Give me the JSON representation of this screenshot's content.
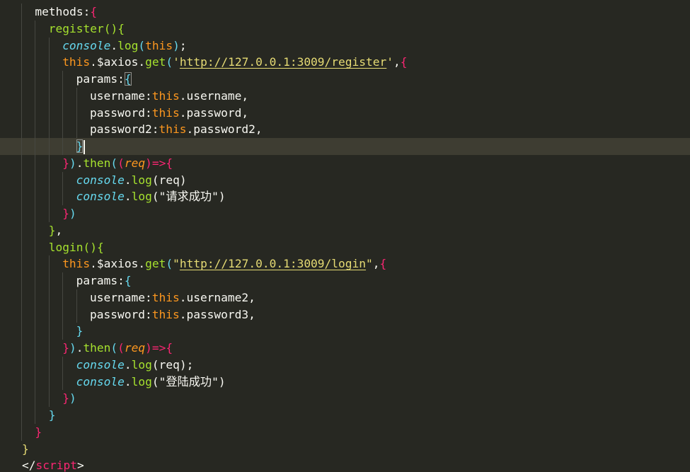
{
  "editor": {
    "theme_colors": {
      "background": "#272822",
      "current_line": "#3e3d32",
      "function": "#a6e22e",
      "keyword": "#fd971f",
      "property": "#66d9ef",
      "string": "#e6db74",
      "operator": "#f92672"
    },
    "lines": [
      {
        "indent": 2,
        "tokens": [
          {
            "t": "methods:",
            "c": "plain"
          },
          {
            "t": "{",
            "c": "p3"
          }
        ]
      },
      {
        "indent": 3,
        "tokens": [
          {
            "t": "register",
            "c": "fn"
          },
          {
            "t": "()",
            "c": "p2"
          },
          {
            "t": "{",
            "c": "p2"
          }
        ]
      },
      {
        "indent": 4,
        "tokens": [
          {
            "t": "console",
            "c": "prop"
          },
          {
            "t": ".",
            "c": "plain"
          },
          {
            "t": "log",
            "c": "fn"
          },
          {
            "t": "(",
            "c": "p4"
          },
          {
            "t": "this",
            "c": "kw"
          },
          {
            "t": ")",
            "c": "p4"
          },
          {
            "t": ";",
            "c": "plain"
          }
        ]
      },
      {
        "indent": 4,
        "tokens": [
          {
            "t": "this",
            "c": "kw"
          },
          {
            "t": ".$axios.",
            "c": "plain"
          },
          {
            "t": "get",
            "c": "fn"
          },
          {
            "t": "(",
            "c": "p4"
          },
          {
            "t": "'",
            "c": "str"
          },
          {
            "t": "http://127.0.0.1:3009/register",
            "c": "url"
          },
          {
            "t": "'",
            "c": "str"
          },
          {
            "t": ",",
            "c": "plain"
          },
          {
            "t": "{",
            "c": "p3"
          }
        ]
      },
      {
        "indent": 5,
        "tokens": [
          {
            "t": "params:",
            "c": "plain"
          },
          {
            "t": "{",
            "c": "p4",
            "box": true
          }
        ]
      },
      {
        "indent": 6,
        "tokens": [
          {
            "t": "username:",
            "c": "plain"
          },
          {
            "t": "this",
            "c": "kw"
          },
          {
            "t": ".username,",
            "c": "plain"
          }
        ]
      },
      {
        "indent": 6,
        "tokens": [
          {
            "t": "password:",
            "c": "plain"
          },
          {
            "t": "this",
            "c": "kw"
          },
          {
            "t": ".password,",
            "c": "plain"
          }
        ]
      },
      {
        "indent": 6,
        "tokens": [
          {
            "t": "password2:",
            "c": "plain"
          },
          {
            "t": "this",
            "c": "kw"
          },
          {
            "t": ".password2,",
            "c": "plain"
          }
        ]
      },
      {
        "indent": 5,
        "current": true,
        "tokens": [
          {
            "t": "}",
            "c": "p4",
            "box": true,
            "caret": true
          }
        ]
      },
      {
        "indent": 4,
        "tokens": [
          {
            "t": "}",
            "c": "p3"
          },
          {
            "t": ")",
            "c": "p4"
          },
          {
            "t": ".",
            "c": "plain"
          },
          {
            "t": "then",
            "c": "fn"
          },
          {
            "t": "(",
            "c": "p4"
          },
          {
            "t": "(",
            "c": "p3"
          },
          {
            "t": "req",
            "c": "param"
          },
          {
            "t": ")",
            "c": "p3"
          },
          {
            "t": "=>",
            "c": "arrow"
          },
          {
            "t": "{",
            "c": "p3"
          }
        ]
      },
      {
        "indent": 5,
        "tokens": [
          {
            "t": "console",
            "c": "prop"
          },
          {
            "t": ".",
            "c": "plain"
          },
          {
            "t": "log",
            "c": "fn"
          },
          {
            "t": "(",
            "c": "p1"
          },
          {
            "t": "req",
            "c": "plain"
          },
          {
            "t": ")",
            "c": "p1"
          }
        ]
      },
      {
        "indent": 5,
        "tokens": [
          {
            "t": "console",
            "c": "prop"
          },
          {
            "t": ".",
            "c": "plain"
          },
          {
            "t": "log",
            "c": "fn"
          },
          {
            "t": "(",
            "c": "p1"
          },
          {
            "t": "\"请求成功\"",
            "c": "plain"
          },
          {
            "t": ")",
            "c": "p1"
          }
        ]
      },
      {
        "indent": 4,
        "tokens": [
          {
            "t": "}",
            "c": "p3"
          },
          {
            "t": ")",
            "c": "p4"
          }
        ]
      },
      {
        "indent": 3,
        "tokens": [
          {
            "t": "}",
            "c": "p2"
          },
          {
            "t": ",",
            "c": "plain"
          }
        ]
      },
      {
        "indent": 3,
        "tokens": [
          {
            "t": "login",
            "c": "fn"
          },
          {
            "t": "()",
            "c": "p2"
          },
          {
            "t": "{",
            "c": "p2"
          }
        ]
      },
      {
        "indent": 4,
        "tokens": [
          {
            "t": "this",
            "c": "kw"
          },
          {
            "t": ".$axios.",
            "c": "plain"
          },
          {
            "t": "get",
            "c": "fn"
          },
          {
            "t": "(",
            "c": "p4"
          },
          {
            "t": "\"",
            "c": "str"
          },
          {
            "t": "http://127.0.0.1:3009/login",
            "c": "url"
          },
          {
            "t": "\"",
            "c": "str"
          },
          {
            "t": ",",
            "c": "plain"
          },
          {
            "t": "{",
            "c": "p3"
          }
        ]
      },
      {
        "indent": 5,
        "tokens": [
          {
            "t": "params:",
            "c": "plain"
          },
          {
            "t": "{",
            "c": "p4"
          }
        ]
      },
      {
        "indent": 6,
        "tokens": [
          {
            "t": "username:",
            "c": "plain"
          },
          {
            "t": "this",
            "c": "kw"
          },
          {
            "t": ".username2,",
            "c": "plain"
          }
        ]
      },
      {
        "indent": 6,
        "tokens": [
          {
            "t": "password:",
            "c": "plain"
          },
          {
            "t": "this",
            "c": "kw"
          },
          {
            "t": ".password3,",
            "c": "plain"
          }
        ]
      },
      {
        "indent": 5,
        "tokens": [
          {
            "t": "}",
            "c": "p4"
          }
        ]
      },
      {
        "indent": 4,
        "tokens": [
          {
            "t": "}",
            "c": "p3"
          },
          {
            "t": ")",
            "c": "p4"
          },
          {
            "t": ".",
            "c": "plain"
          },
          {
            "t": "then",
            "c": "fn"
          },
          {
            "t": "(",
            "c": "p4"
          },
          {
            "t": "(",
            "c": "p3"
          },
          {
            "t": "req",
            "c": "param"
          },
          {
            "t": ")",
            "c": "p3"
          },
          {
            "t": "=>",
            "c": "arrow"
          },
          {
            "t": "{",
            "c": "p3"
          }
        ]
      },
      {
        "indent": 5,
        "tokens": [
          {
            "t": "console",
            "c": "prop"
          },
          {
            "t": ".",
            "c": "plain"
          },
          {
            "t": "log",
            "c": "fn"
          },
          {
            "t": "(",
            "c": "p1"
          },
          {
            "t": "req",
            "c": "plain"
          },
          {
            "t": ")",
            "c": "p1"
          },
          {
            "t": ";",
            "c": "plain"
          }
        ]
      },
      {
        "indent": 5,
        "tokens": [
          {
            "t": "console",
            "c": "prop"
          },
          {
            "t": ".",
            "c": "plain"
          },
          {
            "t": "log",
            "c": "fn"
          },
          {
            "t": "(",
            "c": "p1"
          },
          {
            "t": "\"登陆成功\"",
            "c": "plain"
          },
          {
            "t": ")",
            "c": "p1"
          }
        ]
      },
      {
        "indent": 4,
        "tokens": [
          {
            "t": "}",
            "c": "p3"
          },
          {
            "t": ")",
            "c": "p4"
          }
        ]
      },
      {
        "indent": 3,
        "tokens": [
          {
            "t": "}",
            "c": "p4"
          }
        ]
      },
      {
        "indent": 2,
        "tokens": [
          {
            "t": "}",
            "c": "p3"
          }
        ]
      },
      {
        "indent": 1,
        "tokens": [
          {
            "t": "}",
            "c": "str"
          }
        ]
      },
      {
        "indent": 1,
        "tokens": [
          {
            "t": "</",
            "c": "plain"
          },
          {
            "t": "script",
            "c": "tagkw"
          },
          {
            "t": ">",
            "c": "plain"
          }
        ]
      }
    ]
  }
}
